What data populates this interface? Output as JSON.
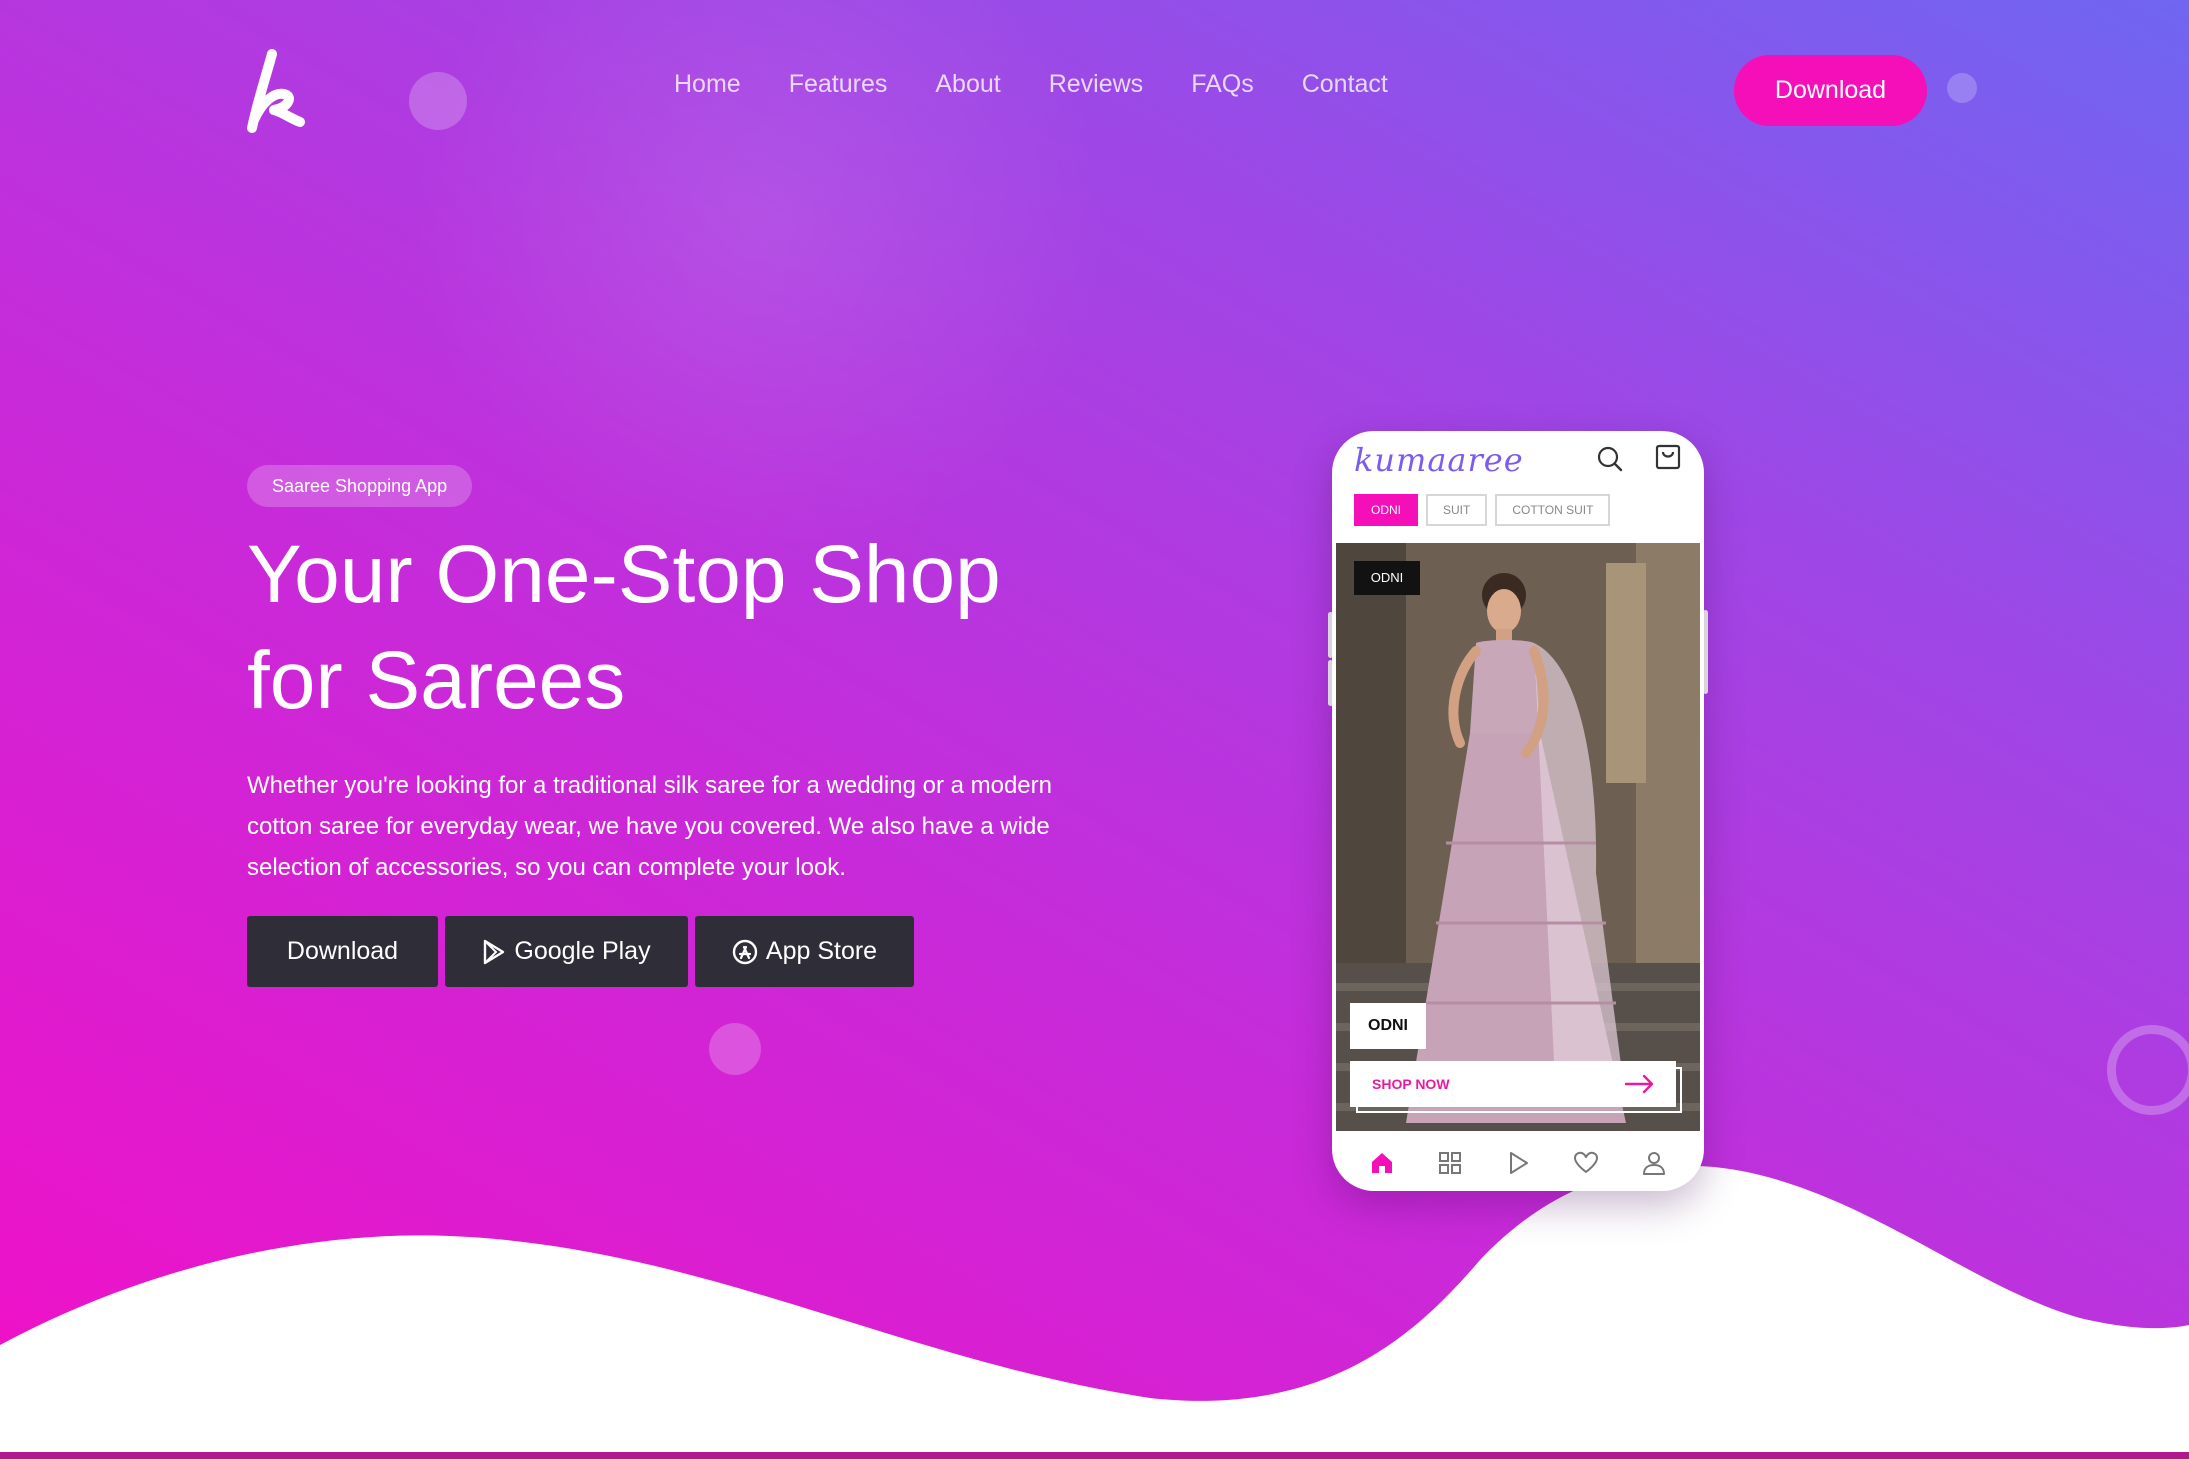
{
  "brand": {
    "logo_icon": "k-script-logo-icon",
    "colors": {
      "accent": "#f50fb9",
      "gradient_start": "#f20fc6",
      "gradient_end": "#6f66f2",
      "button_dark": "#2f2d37"
    }
  },
  "nav": {
    "items": [
      {
        "label": "Home"
      },
      {
        "label": "Features"
      },
      {
        "label": "About"
      },
      {
        "label": "Reviews"
      },
      {
        "label": "FAQs"
      },
      {
        "label": "Contact"
      }
    ],
    "download_label": "Download"
  },
  "hero": {
    "badge": "Saaree Shopping App",
    "headline_line1": "Your One-Stop Shop",
    "headline_line2": "for Sarees",
    "lead": "Whether you're looking for a traditional silk saree for a wedding or a modern cotton saree for everyday wear, we have you covered. We also have a wide selection of accessories, so you can complete your look.",
    "buttons": {
      "download": "Download",
      "google_play": "Google Play",
      "app_store": "App Store"
    }
  },
  "phone": {
    "app_name": "kumaaree",
    "header_icons": [
      "search-icon",
      "shopping-bag-icon"
    ],
    "chips": [
      {
        "label": "ODNI",
        "active": true
      },
      {
        "label": "SUIT",
        "active": false
      },
      {
        "label": "COTTON SUIT",
        "active": false
      }
    ],
    "product": {
      "top_tag": "ODNI",
      "label": "ODNI",
      "cta": "SHOP NOW"
    },
    "bottom_nav": [
      "home-icon",
      "grid-icon",
      "play-icon",
      "heart-icon",
      "user-icon"
    ]
  }
}
